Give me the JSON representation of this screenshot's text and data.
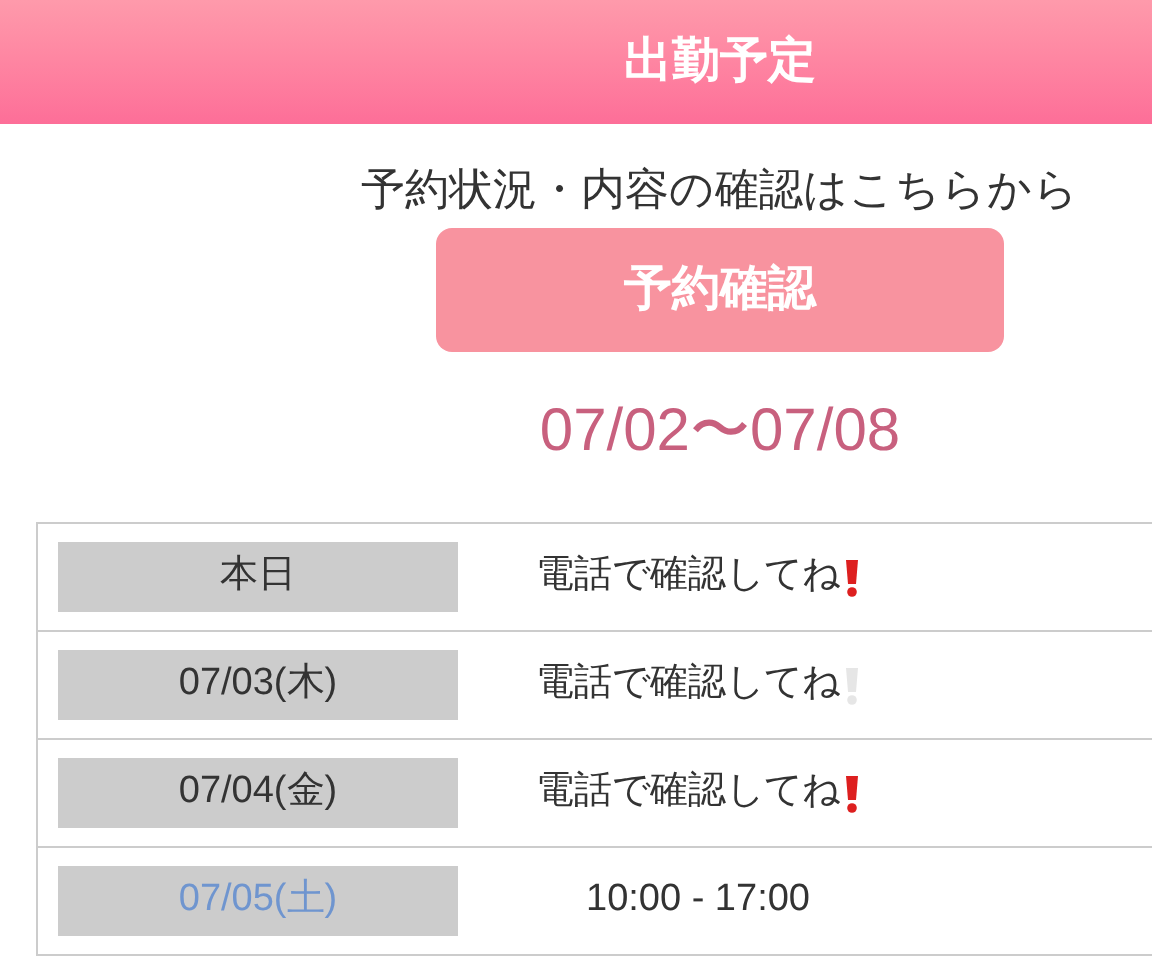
{
  "header": {
    "title": "出勤予定"
  },
  "reservation": {
    "note": "予約状況・内容の確認はこちらから",
    "button": "予約確認"
  },
  "period": "07/02〜07/08",
  "schedule": [
    {
      "date": "本日",
      "color": "#333333",
      "status": "電話で確認してね",
      "alert": true
    },
    {
      "date": "07/03(木)",
      "color": "#333333",
      "status": "電話で確認してね",
      "alert": false
    },
    {
      "date": "07/04(金)",
      "color": "#333333",
      "status": "電話で確認してね",
      "alert": true
    },
    {
      "date": "07/05(土)",
      "color": "#6f95cf",
      "status": "10:00 - 17:00"
    }
  ]
}
